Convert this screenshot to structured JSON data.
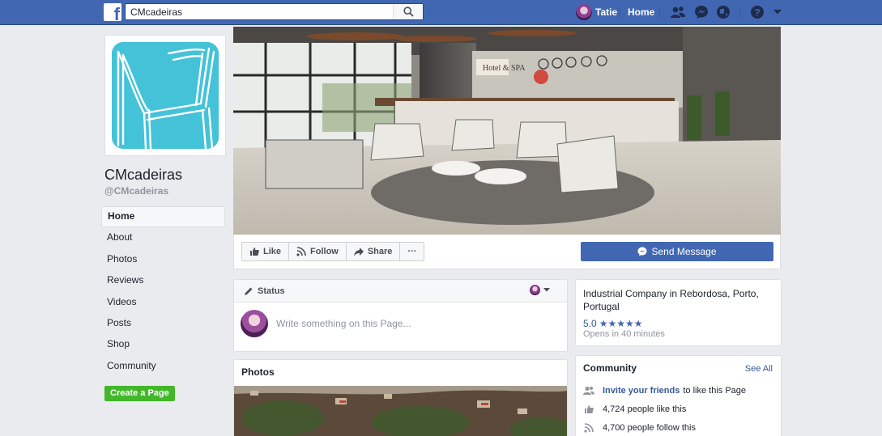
{
  "topbar": {
    "search_value": "CMcadeiras",
    "user_name": "Tatie",
    "home_label": "Home",
    "logo_letter": "f"
  },
  "page": {
    "name": "CMcadeiras",
    "handle": "@CMcadeiras"
  },
  "left_nav": {
    "items": [
      {
        "label": "Home",
        "active": true
      },
      {
        "label": "About"
      },
      {
        "label": "Photos"
      },
      {
        "label": "Reviews"
      },
      {
        "label": "Videos"
      },
      {
        "label": "Posts"
      },
      {
        "label": "Shop"
      },
      {
        "label": "Community"
      }
    ],
    "create_page_label": "Create a Page"
  },
  "cover": {
    "sign_text": "Hotel & SPA"
  },
  "actions": {
    "like_label": "Like",
    "follow_label": "Follow",
    "share_label": "Share",
    "more_label": "···",
    "send_message_label": "Send Message"
  },
  "composer": {
    "header_label": "Status",
    "placeholder": "Write something on this Page..."
  },
  "photos": {
    "title": "Photos"
  },
  "about": {
    "category": "Industrial Company in Rebordosa, Porto, Portugal",
    "rating": "5.0",
    "stars": 5,
    "hours": "Opens in 40 minutes"
  },
  "community": {
    "title": "Community",
    "see_all": "See All",
    "invite_link": "Invite your friends",
    "invite_rest": "to like this Page",
    "likes_text": "4,724 people like this",
    "follows_text": "4,700 people follow this"
  },
  "colors": {
    "brand_blue": "#4267b2",
    "create_green": "#42b72a",
    "logo_teal": "#44c2d8"
  }
}
